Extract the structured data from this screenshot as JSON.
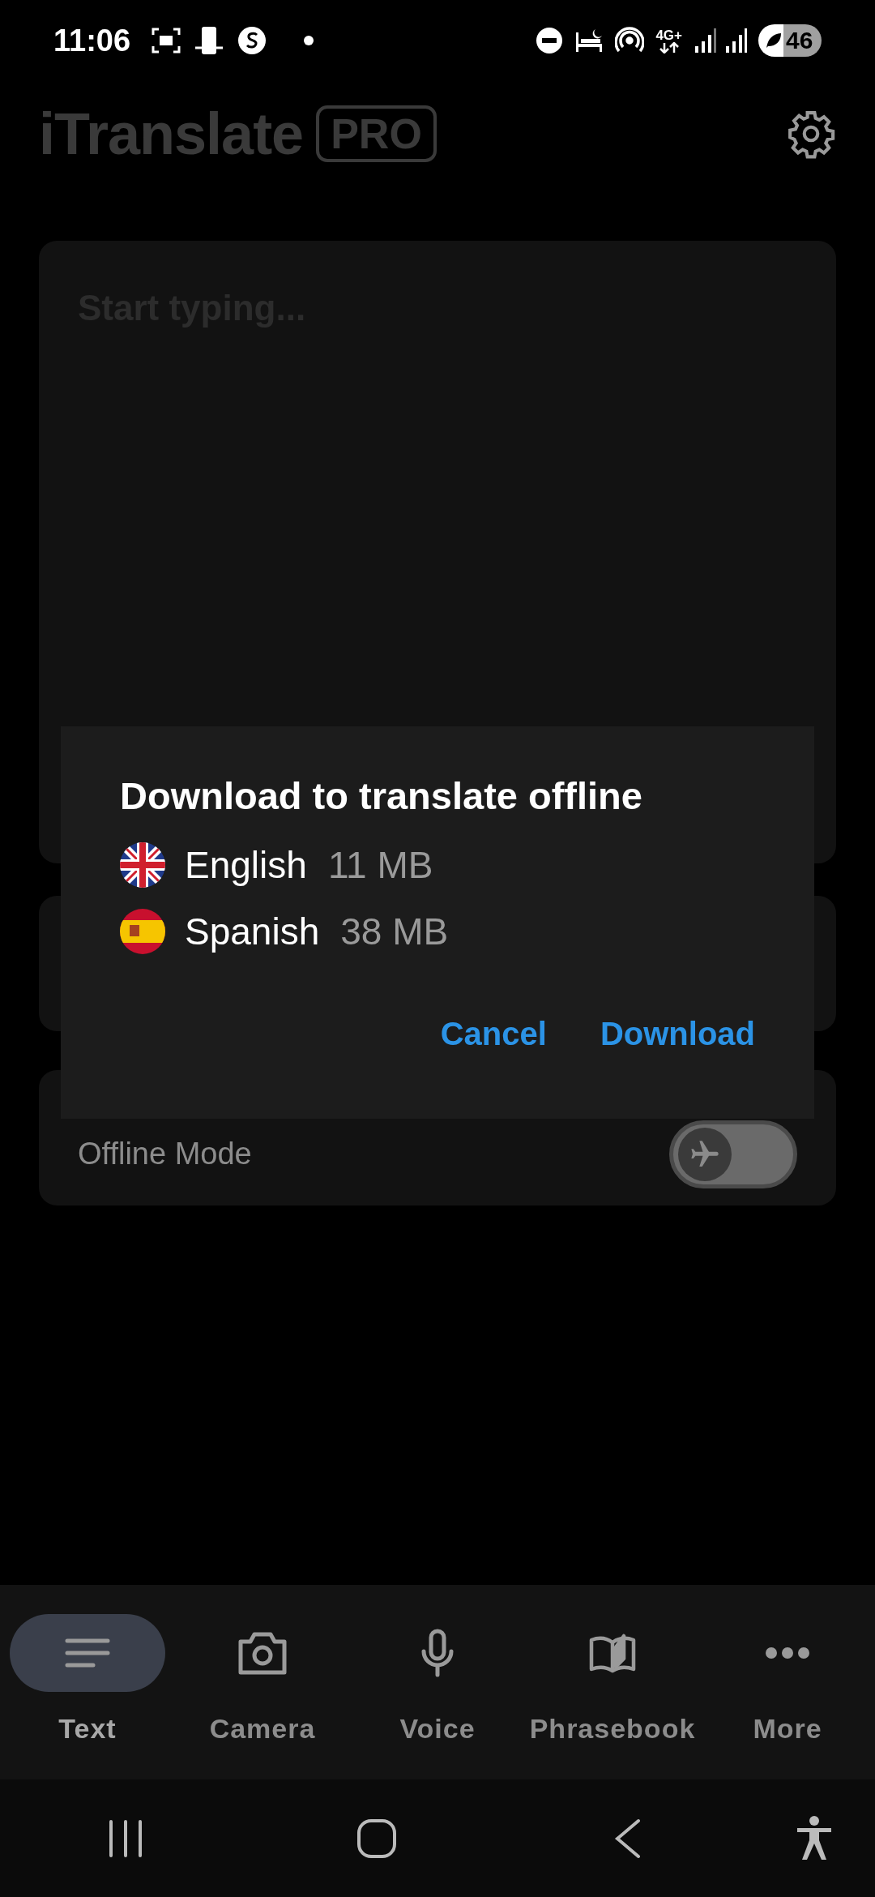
{
  "status_bar": {
    "time": "11:06",
    "network": "4G+",
    "battery": "46"
  },
  "header": {
    "logo": "iTranslate",
    "badge": "PRO"
  },
  "input": {
    "placeholder": "Start typing..."
  },
  "offline_mode": {
    "label": "Offline Mode",
    "on": false
  },
  "dialog": {
    "title": "Download to translate offline",
    "languages": [
      {
        "name": "English",
        "size": "11 MB",
        "kind": "uk"
      },
      {
        "name": "Spanish",
        "size": "38 MB",
        "kind": "es"
      }
    ],
    "buttons": [
      "Cancel",
      "Download"
    ]
  },
  "tabs": [
    {
      "label": "Text",
      "kind": "text",
      "selected": true
    },
    {
      "label": "Camera",
      "kind": "camera",
      "selected": false
    },
    {
      "label": "Voice",
      "kind": "mic",
      "selected": false
    },
    {
      "label": "Phrasebook",
      "kind": "book",
      "selected": false
    },
    {
      "label": "More",
      "kind": "more",
      "selected": false
    }
  ]
}
